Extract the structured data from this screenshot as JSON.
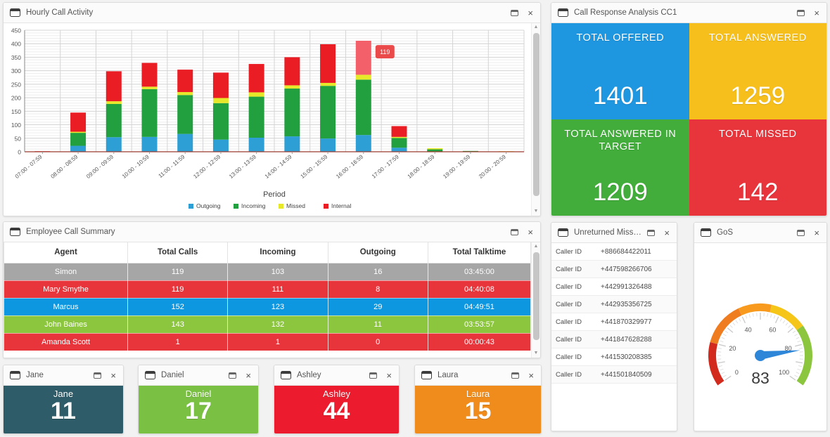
{
  "panels": {
    "hourly": {
      "title": "Hourly Call Activity"
    },
    "response": {
      "title": "Call Response Analysis CC1"
    },
    "employee": {
      "title": "Employee Call Summary"
    },
    "unreturned": {
      "title": "Unreturned Misse..."
    },
    "gos": {
      "title": "GoS"
    }
  },
  "window_controls": {
    "restore": "restore",
    "close": "×"
  },
  "chart_data": {
    "type": "bar",
    "stacked": true,
    "title": "Hourly Call Activity",
    "xlabel": "Period",
    "ylabel": "",
    "ylim": [
      0,
      450
    ],
    "yticks": [
      0,
      50,
      100,
      150,
      200,
      250,
      300,
      350,
      400,
      450
    ],
    "grid": true,
    "legend_position": "bottom",
    "categories": [
      "07:00 - 07:59",
      "08:00 - 08:59",
      "09:00 - 09:59",
      "10:00 - 10:59",
      "11:00 - 11:59",
      "12:00 - 12:59",
      "13:00 - 13:59",
      "14:00 - 14:59",
      "15:00 - 15:59",
      "16:00 - 16:59",
      "17:00 - 17:59",
      "18:00 - 18:59",
      "19:00 - 19:59",
      "20:00 - 20:59"
    ],
    "series": [
      {
        "name": "Outgoing",
        "color": "#2e9fd4",
        "values": [
          0,
          22,
          54,
          55,
          66,
          45,
          52,
          57,
          49,
          62,
          15,
          0,
          0,
          0
        ]
      },
      {
        "name": "Incoming",
        "color": "#22a03f",
        "values": [
          0,
          48,
          123,
          177,
          144,
          135,
          152,
          177,
          195,
          205,
          36,
          9,
          3,
          0
        ]
      },
      {
        "name": "Missed",
        "color": "#e8e82a",
        "values": [
          0,
          4,
          10,
          9,
          11,
          19,
          16,
          12,
          11,
          18,
          4,
          4,
          0,
          2
        ]
      },
      {
        "name": "Internal",
        "color": "#ea1c24",
        "values": [
          2,
          71,
          111,
          88,
          83,
          94,
          105,
          104,
          143,
          126,
          40,
          0,
          0,
          0
        ]
      }
    ],
    "tooltip": {
      "label": "119",
      "series": "Internal",
      "category": "16:00 - 16:59"
    }
  },
  "response_tiles": [
    {
      "label": "TOTAL OFFERED",
      "value": "1401",
      "color": "#1e96e0"
    },
    {
      "label": "TOTAL ANSWERED",
      "value": "1259",
      "color": "#f6bf1b"
    },
    {
      "label": "TOTAL ANSWERED IN TARGET",
      "value": "1209",
      "color": "#42ad3b"
    },
    {
      "label": "TOTAL MISSED",
      "value": "142",
      "color": "#e8353c"
    }
  ],
  "employee_table": {
    "columns": [
      "Agent",
      "Total Calls",
      "Incoming",
      "Outgoing",
      "Total Talktime"
    ],
    "rows": [
      {
        "color": "#a6a6a6",
        "cells": [
          "Simon",
          "119",
          "103",
          "16",
          "03:45:00"
        ]
      },
      {
        "color": "#e8353c",
        "cells": [
          "Mary Smythe",
          "119",
          "111",
          "8",
          "04:40:08"
        ]
      },
      {
        "color": "#0c97e0",
        "cells": [
          "Marcus",
          "152",
          "123",
          "29",
          "04:49:51"
        ]
      },
      {
        "color": "#8cc63e",
        "cells": [
          "John Baines",
          "143",
          "132",
          "11",
          "03:53:57"
        ]
      },
      {
        "color": "#e8353c",
        "cells": [
          "Amanda Scott",
          "1",
          "1",
          "0",
          "00:00:43"
        ]
      }
    ]
  },
  "unreturned_calls": {
    "key_label": "Caller ID",
    "items": [
      "+886684422011",
      "+447598266706",
      "+442991326488",
      "+442935356725",
      "+441870329977",
      "+441847628288",
      "+441530208385",
      "+441501840509"
    ]
  },
  "gos_gauge": {
    "value": "83",
    "min": 0,
    "max": 100,
    "ticks": [
      "0",
      "20",
      "40",
      "60",
      "80",
      "100"
    ],
    "needle_color": "#2e86d8",
    "bands": [
      {
        "from": 0,
        "to": 20,
        "color": "#d32a1e"
      },
      {
        "from": 20,
        "to": 40,
        "color": "#f07c20"
      },
      {
        "from": 40,
        "to": 55,
        "color": "#f79a1e"
      },
      {
        "from": 55,
        "to": 72,
        "color": "#f5c518"
      },
      {
        "from": 72,
        "to": 100,
        "color": "#8cc63e"
      }
    ]
  },
  "agent_tiles": [
    {
      "title": "Jane",
      "name": "Jane",
      "value": "11",
      "color": "#2e5c68"
    },
    {
      "title": "Daniel",
      "name": "Daniel",
      "value": "17",
      "color": "#7ac143"
    },
    {
      "title": "Ashley",
      "name": "Ashley",
      "value": "44",
      "color": "#ec1c2e"
    },
    {
      "title": "Laura",
      "name": "Laura",
      "value": "15",
      "color": "#f08c1b"
    }
  ]
}
